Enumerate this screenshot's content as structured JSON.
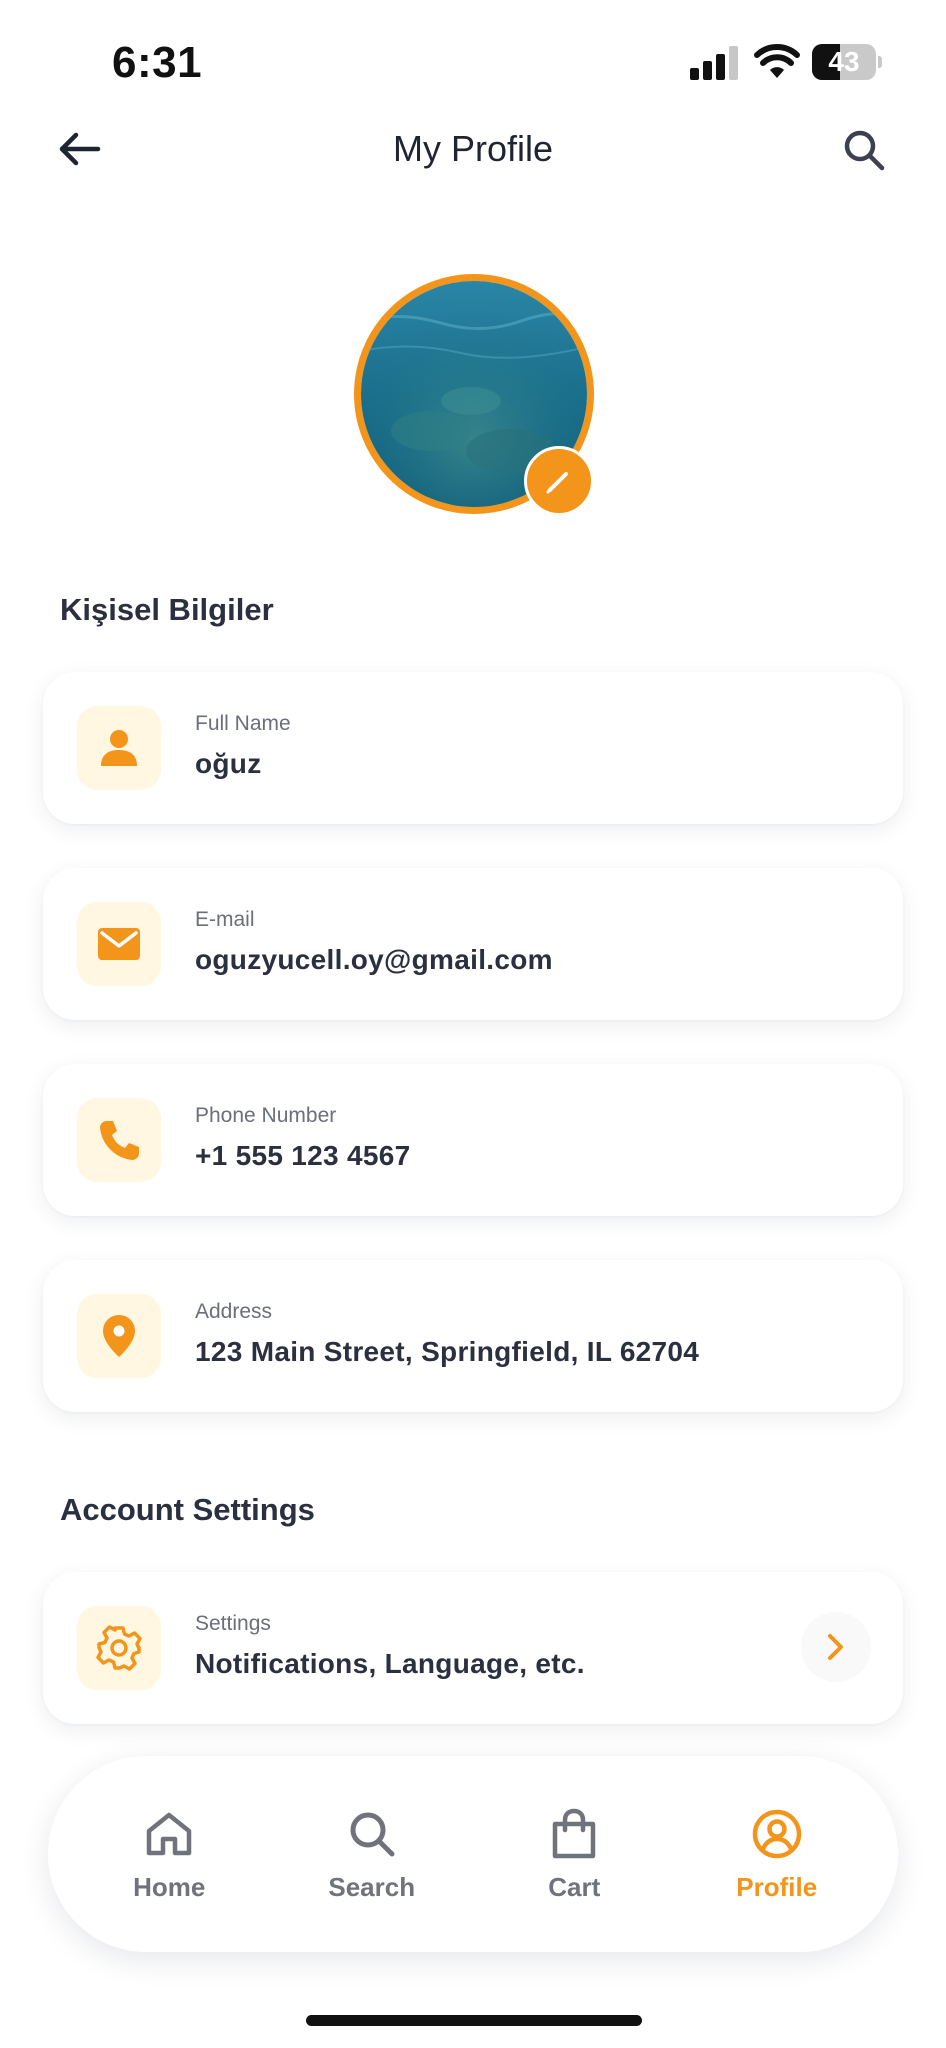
{
  "status_bar": {
    "time": "6:31",
    "battery": "43",
    "battery_level": 0.43
  },
  "header": {
    "title": "My Profile"
  },
  "colors": {
    "accent": "#f3941b",
    "icon_bg": "#fff7e2",
    "text_primary": "#2b3040",
    "text_secondary": "#6a6f7b"
  },
  "personal_section": {
    "title": "Kişisel Bilgiler",
    "items": [
      {
        "icon": "person-icon",
        "label": "Full Name",
        "value": "oğuz"
      },
      {
        "icon": "mail-icon",
        "label": "E-mail",
        "value": "oguzyucell.oy@gmail.com"
      },
      {
        "icon": "phone-icon",
        "label": "Phone Number",
        "value": "+1 555 123 4567"
      },
      {
        "icon": "location-pin-icon",
        "label": "Address",
        "value": "123 Main Street, Springfield, IL 62704"
      }
    ]
  },
  "account_section": {
    "title": "Account Settings",
    "items": [
      {
        "icon": "gear-icon",
        "label": "Settings",
        "value": "Notifications, Language, etc."
      }
    ]
  },
  "bottom_nav": {
    "items": [
      {
        "label": "Home",
        "icon": "home-icon"
      },
      {
        "label": "Search",
        "icon": "search-icon"
      },
      {
        "label": "Cart",
        "icon": "shopping-bag-icon"
      },
      {
        "label": "Profile",
        "icon": "user-circle-icon",
        "active": true
      }
    ]
  }
}
